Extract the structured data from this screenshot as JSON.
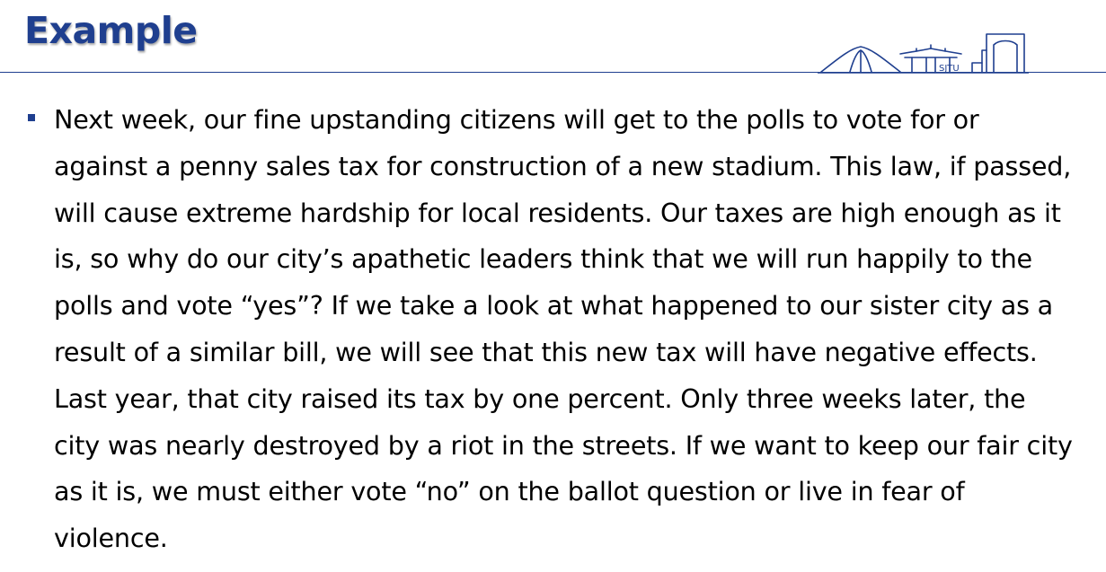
{
  "slide": {
    "title": "Example",
    "bullets": [
      {
        "text": "Next week, our fine upstanding citizens will get to the polls to vote for or against a penny sales tax for construction of a new stadium. This law, if passed, will cause extreme hardship for local residents. Our taxes are high enough as it is, so why do our city’s apathetic leaders think that we will run happily to the polls and vote “yes”? If we take a look at what happened to our sister city as a result of a similar bill, we will see that this new tax will have negative effects. Last year, that city raised its tax by one percent. Only three weeks later, the city was nearly destroyed by a riot in the streets. If we want to keep our fair city as it is, we must either vote “no” on the ballot question or live in fear of violence."
      }
    ]
  },
  "logo": {
    "text": "SJTU",
    "icon": "sjtu-campus-logo-icon"
  },
  "colors": {
    "accent": "#1f3f8f",
    "text": "#000000",
    "background": "#ffffff"
  }
}
